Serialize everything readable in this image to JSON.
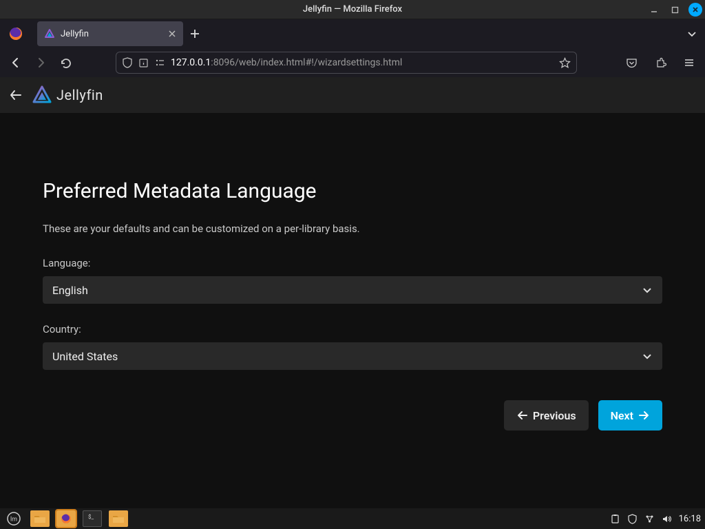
{
  "window_title": "Jellyfin — Mozilla Firefox",
  "browser": {
    "tab_label": "Jellyfin",
    "url": {
      "host": "127.0.0.1",
      "path": ":8096/web/index.html#!/wizardsettings.html"
    }
  },
  "jellyfin": {
    "brand": "Jellyfin",
    "accent": "#00a4dc",
    "heading": "Preferred Metadata Language",
    "description": "These are your defaults and can be customized on a per-library basis.",
    "fields": {
      "language": {
        "label": "Language:",
        "value": "English"
      },
      "country": {
        "label": "Country:",
        "value": "United States"
      }
    },
    "buttons": {
      "previous": "Previous",
      "next": "Next"
    }
  },
  "panel": {
    "clock": "16:18"
  }
}
